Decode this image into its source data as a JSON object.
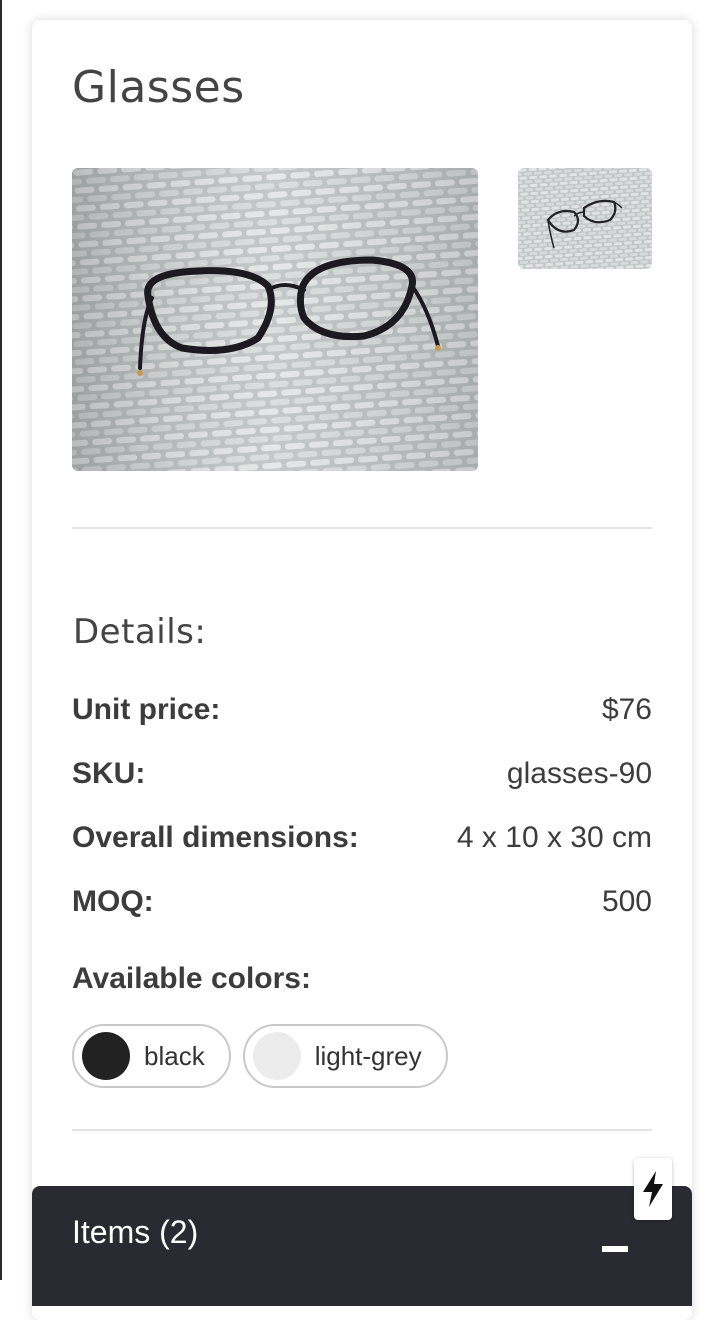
{
  "product": {
    "title": "Glasses",
    "images": [
      {
        "icon": "glasses-photo-icon",
        "selected": true
      },
      {
        "icon": "glasses-photo-icon",
        "selected": false
      }
    ]
  },
  "details": {
    "heading": "Details:",
    "rows": [
      {
        "label": "Unit price:",
        "value": "$76"
      },
      {
        "label": "SKU:",
        "value": "glasses-90"
      },
      {
        "label": "Overall dimensions:",
        "value": "4 x 10 x 30 cm"
      },
      {
        "label": "MOQ:",
        "value": "500"
      }
    ],
    "colors_label": "Available colors:",
    "colors": [
      {
        "name": "black",
        "hex": "#222222"
      },
      {
        "name": "light-grey",
        "hex": "#ececec"
      }
    ]
  },
  "footer": {
    "items_label": "Items (2)",
    "toggle_icon": "minus-icon",
    "badge_icon": "lightning-bolt-icon"
  },
  "theme": {
    "footer_bg": "#2a2a32",
    "text": "#3c3c3c",
    "divider": "#e3e3e3"
  }
}
